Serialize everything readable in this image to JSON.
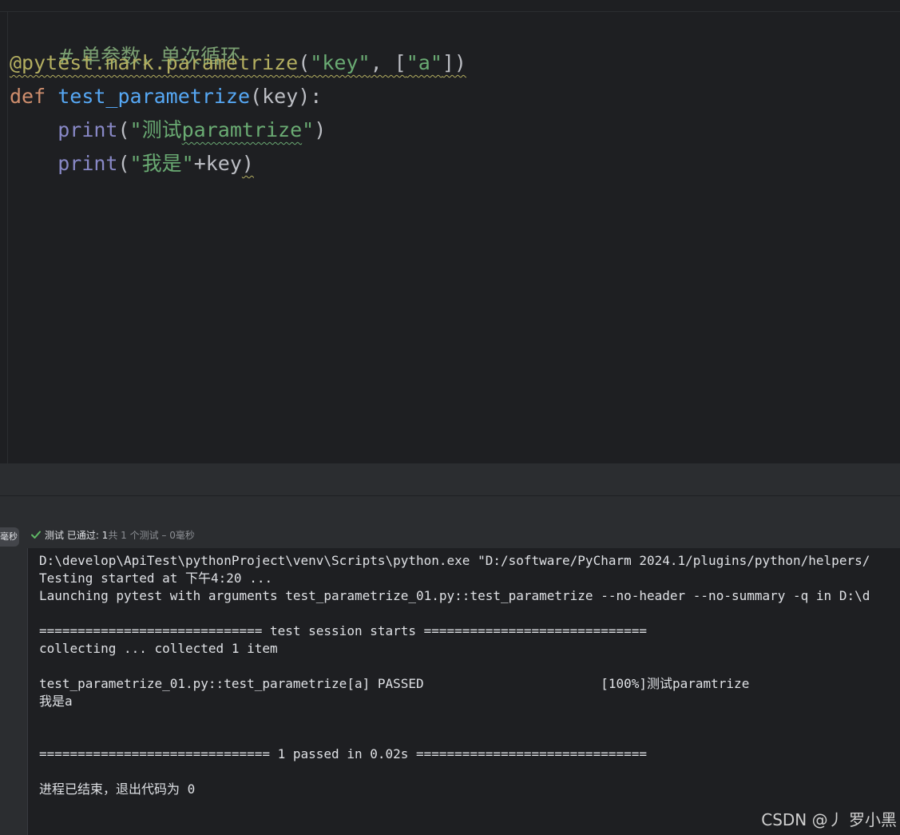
{
  "editor": {
    "comment": "# 单参数，单次循环",
    "decorator": {
      "prefix": "@pytest.mark.parametrize",
      "open": "(",
      "arg1": "\"key\"",
      "sep": ", [",
      "arg2": "\"a\"",
      "close": "])"
    },
    "def_line": {
      "keyword": "def",
      "name": "test_parametrize",
      "params": "(key):"
    },
    "print1": {
      "fn": "print",
      "open": "(",
      "str_q1": "\"",
      "str_cjk": "测试",
      "str_ascii": "paramtrize",
      "str_q2": "\"",
      "close": ")"
    },
    "print2": {
      "fn": "print",
      "open": "(",
      "str_q1": "\"",
      "str_cjk": "我是",
      "str_q2": "\"",
      "rest": "+key",
      "close": ")"
    }
  },
  "run_panel": {
    "side_tag": "毫秒",
    "status": {
      "label": "测试 已通过: 1",
      "detail": "共 1 个测试 – 0毫秒"
    },
    "console_lines": [
      "D:\\develop\\ApiTest\\pythonProject\\venv\\Scripts\\python.exe \"D:/software/PyCharm 2024.1/plugins/python/helpers/",
      "Testing started at 下午4:20 ...",
      "Launching pytest with arguments test_parametrize_01.py::test_parametrize --no-header --no-summary -q in D:\\d",
      "",
      "============================= test session starts =============================",
      "collecting ... collected 1 item",
      "",
      "test_parametrize_01.py::test_parametrize[a] PASSED                       [100%]测试paramtrize",
      "我是a",
      "",
      "",
      "============================== 1 passed in 0.02s ==============================",
      "",
      "进程已结束，退出代码为 0"
    ]
  },
  "watermark": "CSDN @丿 罗小黑",
  "colors": {
    "editor_bg": "#1e1f22",
    "panel_bg": "#2b2d30",
    "comment": "#7a9f72",
    "decorator": "#b3ae60",
    "keyword": "#cf8e6d",
    "function": "#56a8f5",
    "builtin": "#8888c6",
    "string": "#6aab73",
    "text": "#bcbec4",
    "success": "#5fb865"
  },
  "icons": {
    "status_icon": "check-icon"
  }
}
